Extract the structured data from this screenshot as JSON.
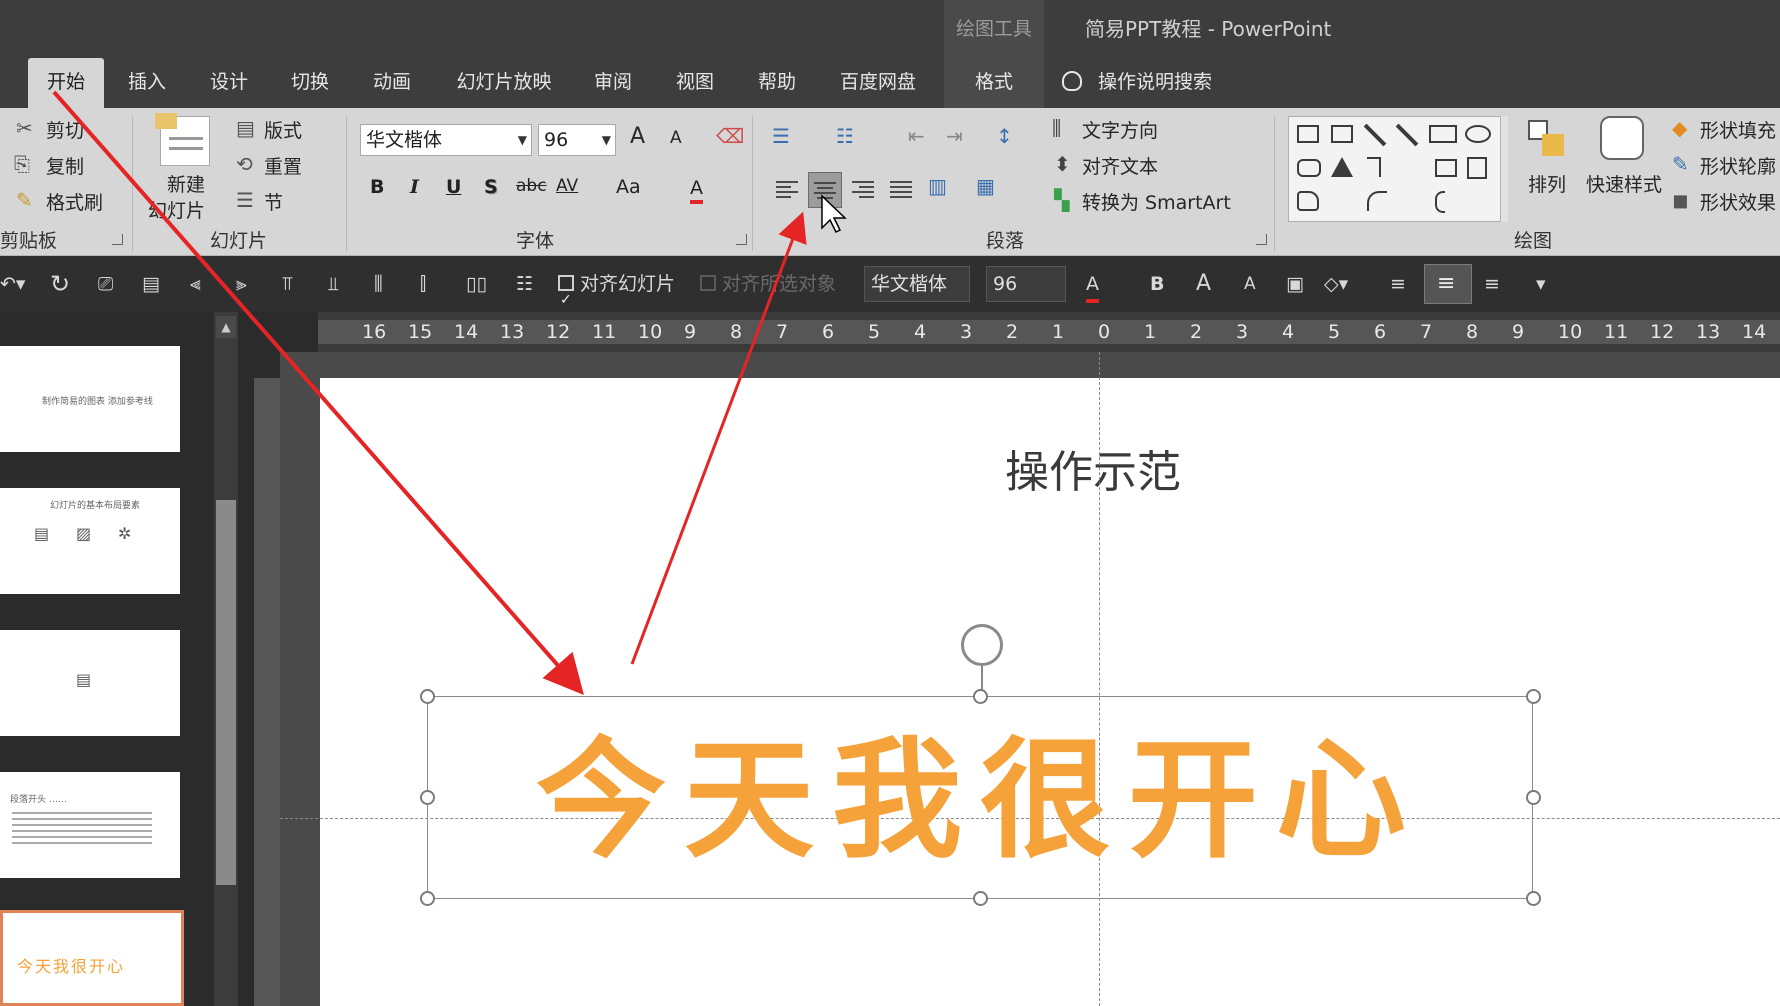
{
  "titlebar": {
    "context_tool": "绘图工具",
    "document_title": "简易PPT教程  -  PowerPoint"
  },
  "tabs": [
    {
      "label": "开始",
      "active": true
    },
    {
      "label": "插入"
    },
    {
      "label": "设计"
    },
    {
      "label": "切换"
    },
    {
      "label": "动画"
    },
    {
      "label": "幻灯片放映"
    },
    {
      "label": "审阅"
    },
    {
      "label": "视图"
    },
    {
      "label": "帮助"
    },
    {
      "label": "百度网盘"
    },
    {
      "label": "格式"
    }
  ],
  "tell_me": {
    "label": "操作说明搜索"
  },
  "ribbon": {
    "clipboard": {
      "cut": "剪切",
      "copy": "复制",
      "format_painter": "格式刷",
      "group_label": "剪贴板"
    },
    "slides": {
      "new_slide_line1": "新建",
      "new_slide_line2": "幻灯片",
      "layout": "版式",
      "reset": "重置",
      "section": "节",
      "group_label": "幻灯片"
    },
    "font": {
      "font_name": "华文楷体",
      "font_size": "96",
      "grow": "A",
      "shrink": "A",
      "bold": "B",
      "italic": "I",
      "underline": "U",
      "shadow": "S",
      "strike": "abc",
      "spacing": "AV",
      "case": "Aa",
      "color": "A",
      "group_label": "字体"
    },
    "paragraph": {
      "text_direction": "文字方向",
      "align_text": "对齐文本",
      "convert_smartart": "转换为 SmartArt",
      "group_label": "段落"
    },
    "drawing": {
      "arrange": "排列",
      "quick_styles": "快速样式",
      "shape_fill": "形状填充",
      "shape_outline": "形状轮廓",
      "shape_effects": "形状效果",
      "group_label": "绘图"
    }
  },
  "format_toolbar": {
    "align_to_slide": "对齐幻灯片",
    "align_selected": "对齐所选对象",
    "font_name": "华文楷体",
    "font_size": "96",
    "bold": "B"
  },
  "ruler": {
    "labels": [
      "16",
      "15",
      "14",
      "13",
      "12",
      "11",
      "10",
      "9",
      "8",
      "7",
      "6",
      "5",
      "4",
      "3",
      "2",
      "1",
      "0",
      "1",
      "2",
      "3",
      "4",
      "5",
      "6",
      "7",
      "8",
      "9",
      "10",
      "11",
      "12",
      "13",
      "14"
    ]
  },
  "thumbnails": [
    {
      "text": "制作简易的图表  添加参考线"
    },
    {
      "text": "幻灯片的基本布局要素"
    },
    {
      "text": ""
    },
    {
      "text": "段落开头 ……"
    },
    {
      "text": "今天我很开心",
      "selected": true
    }
  ],
  "slide": {
    "title": "操作示范",
    "body_text": "今天我很开心",
    "text_color": "#f5a23a"
  },
  "colors": {
    "accent_red": "#e52525",
    "tab_active_bg": "#d6d6d6",
    "dark_bg": "#3d3d3d"
  }
}
